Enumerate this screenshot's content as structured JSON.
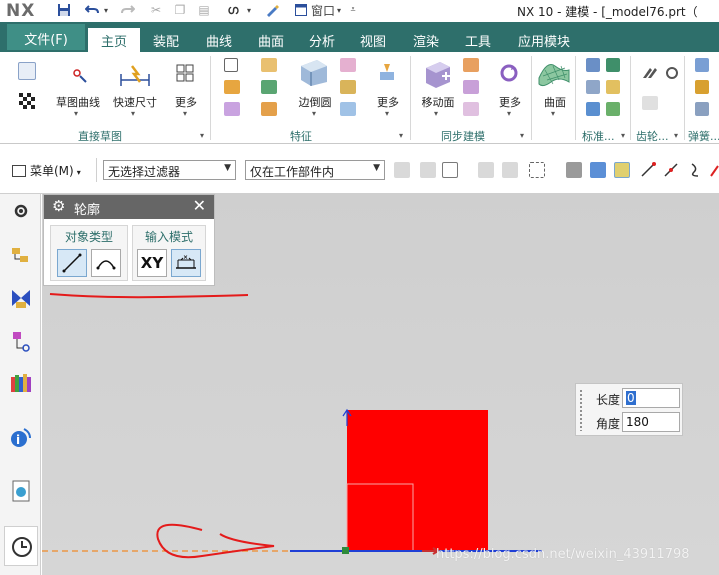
{
  "app": {
    "logo": "NX",
    "window_title": "NX 10 - 建模 - [_model76.prt（"
  },
  "quick_access": {
    "window_menu_label": "窗口"
  },
  "tabs": [
    {
      "label": "文件(F)"
    },
    {
      "label": "主页"
    },
    {
      "label": "装配"
    },
    {
      "label": "曲线"
    },
    {
      "label": "曲面"
    },
    {
      "label": "分析"
    },
    {
      "label": "视图"
    },
    {
      "label": "渲染"
    },
    {
      "label": "工具"
    },
    {
      "label": "应用模块"
    }
  ],
  "ribbon": {
    "sketch_curve_label": "草图曲线",
    "quick_dim_label": "快速尺寸",
    "more_label_1": "更多",
    "group_direct_sketch": "直接草图",
    "edge_blend_label": "边倒圆",
    "more_label_2": "更多",
    "group_feature": "特征",
    "move_face_label": "移动面",
    "more_label_3": "更多",
    "group_sync_modeling": "同步建模",
    "surface_label": "曲面",
    "group_standard": "标准...",
    "group_gear": "齿轮...",
    "group_spring": "弹簧..."
  },
  "selection_bar": {
    "menu_label": "菜单(M)",
    "filter_value": "无选择过滤器",
    "scope_value": "仅在工作部件内"
  },
  "profile_dialog": {
    "title": "轮廓",
    "object_type_label": "对象类型",
    "input_mode_label": "输入模式",
    "xy_label": "XY"
  },
  "dynamic_input": {
    "length_label": "长度",
    "length_value": "0",
    "angle_label": "角度",
    "angle_value": "180"
  },
  "watermark": "https://blog.csdn.net/weixin_43911798",
  "colors": {
    "ribbon_tab_bg": "#2e6f6b",
    "file_tab_bg": "#3f8f86",
    "sketch_fill": "#ff0000",
    "annotation_red": "#e41b1b",
    "axis_blue": "#1f3fd6",
    "origin_dash": "#f08b2a"
  }
}
